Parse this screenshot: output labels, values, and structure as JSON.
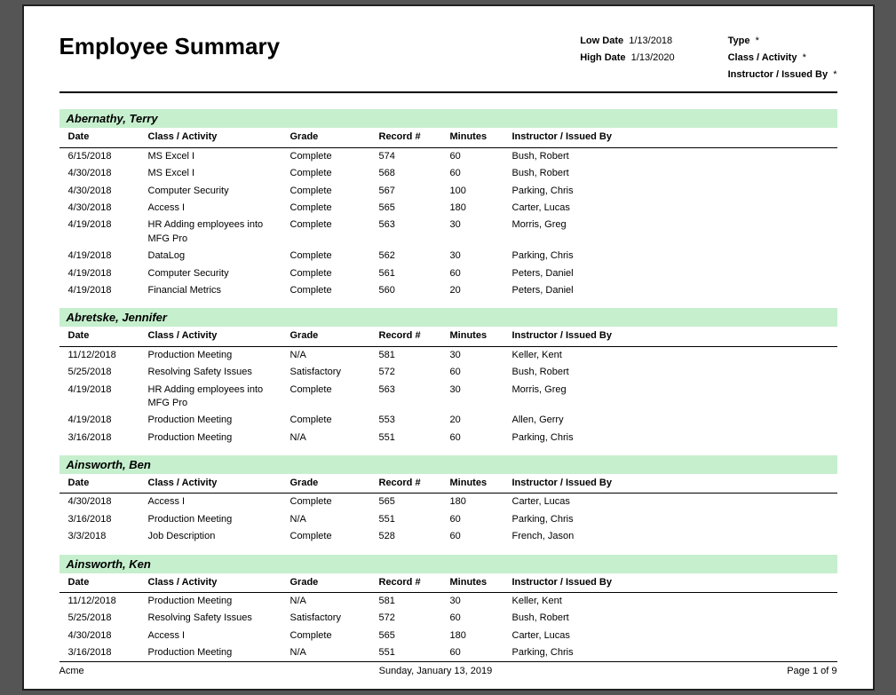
{
  "title": "Employee Summary",
  "filters": {
    "low_date_label": "Low Date",
    "low_date_value": "1/13/2018",
    "high_date_label": "High Date",
    "high_date_value": "1/13/2020",
    "type_label": "Type",
    "type_value": "*",
    "class_label": "Class / Activity",
    "class_value": "*",
    "instructor_label": "Instructor / Issued By",
    "instructor_value": "*"
  },
  "columns": {
    "date": "Date",
    "class_activity": "Class / Activity",
    "grade": "Grade",
    "record_num": "Record #",
    "minutes": "Minutes",
    "instructor": "Instructor / Issued By"
  },
  "employees": [
    {
      "name": "Abernathy, Terry",
      "rows": [
        {
          "date": "6/15/2018",
          "class": "MS Excel I",
          "grade": "Complete",
          "record": "574",
          "minutes": "60",
          "instructor": "Bush, Robert"
        },
        {
          "date": "4/30/2018",
          "class": "MS Excel I",
          "grade": "Complete",
          "record": "568",
          "minutes": "60",
          "instructor": "Bush, Robert"
        },
        {
          "date": "4/30/2018",
          "class": "Computer Security",
          "grade": "Complete",
          "record": "567",
          "minutes": "100",
          "instructor": "Parking, Chris"
        },
        {
          "date": "4/30/2018",
          "class": "Access I",
          "grade": "Complete",
          "record": "565",
          "minutes": "180",
          "instructor": "Carter, Lucas"
        },
        {
          "date": "4/19/2018",
          "class": "HR Adding employees into MFG Pro",
          "grade": "Complete",
          "record": "563",
          "minutes": "30",
          "instructor": "Morris, Greg"
        },
        {
          "date": "4/19/2018",
          "class": "DataLog",
          "grade": "Complete",
          "record": "562",
          "minutes": "30",
          "instructor": "Parking, Chris"
        },
        {
          "date": "4/19/2018",
          "class": "Computer Security",
          "grade": "Complete",
          "record": "561",
          "minutes": "60",
          "instructor": "Peters, Daniel"
        },
        {
          "date": "4/19/2018",
          "class": "Financial Metrics",
          "grade": "Complete",
          "record": "560",
          "minutes": "20",
          "instructor": "Peters, Daniel"
        }
      ]
    },
    {
      "name": "Abretske, Jennifer",
      "rows": [
        {
          "date": "11/12/2018",
          "class": "Production Meeting",
          "grade": "N/A",
          "record": "581",
          "minutes": "30",
          "instructor": "Keller, Kent"
        },
        {
          "date": "5/25/2018",
          "class": "Resolving Safety Issues",
          "grade": "Satisfactory",
          "record": "572",
          "minutes": "60",
          "instructor": "Bush, Robert"
        },
        {
          "date": "4/19/2018",
          "class": "HR Adding employees into MFG Pro",
          "grade": "Complete",
          "record": "563",
          "minutes": "30",
          "instructor": "Morris, Greg"
        },
        {
          "date": "4/19/2018",
          "class": "Production Meeting",
          "grade": "Complete",
          "record": "553",
          "minutes": "20",
          "instructor": "Allen, Gerry"
        },
        {
          "date": "3/16/2018",
          "class": "Production Meeting",
          "grade": "N/A",
          "record": "551",
          "minutes": "60",
          "instructor": "Parking, Chris"
        }
      ]
    },
    {
      "name": "Ainsworth, Ben",
      "rows": [
        {
          "date": "4/30/2018",
          "class": "Access I",
          "grade": "Complete",
          "record": "565",
          "minutes": "180",
          "instructor": "Carter, Lucas"
        },
        {
          "date": "3/16/2018",
          "class": "Production Meeting",
          "grade": "N/A",
          "record": "551",
          "minutes": "60",
          "instructor": "Parking, Chris"
        },
        {
          "date": "3/3/2018",
          "class": "Job Description",
          "grade": "Complete",
          "record": "528",
          "minutes": "60",
          "instructor": "French, Jason"
        }
      ]
    },
    {
      "name": "Ainsworth, Ken",
      "rows": [
        {
          "date": "11/12/2018",
          "class": "Production Meeting",
          "grade": "N/A",
          "record": "581",
          "minutes": "30",
          "instructor": "Keller, Kent"
        },
        {
          "date": "5/25/2018",
          "class": "Resolving Safety Issues",
          "grade": "Satisfactory",
          "record": "572",
          "minutes": "60",
          "instructor": "Bush, Robert"
        },
        {
          "date": "4/30/2018",
          "class": "Access I",
          "grade": "Complete",
          "record": "565",
          "minutes": "180",
          "instructor": "Carter, Lucas"
        },
        {
          "date": "3/16/2018",
          "class": "Production Meeting",
          "grade": "N/A",
          "record": "551",
          "minutes": "60",
          "instructor": "Parking, Chris"
        }
      ]
    }
  ],
  "footer": {
    "company": "Acme",
    "date": "Sunday, January 13, 2019",
    "page": "Page 1 of 9"
  }
}
